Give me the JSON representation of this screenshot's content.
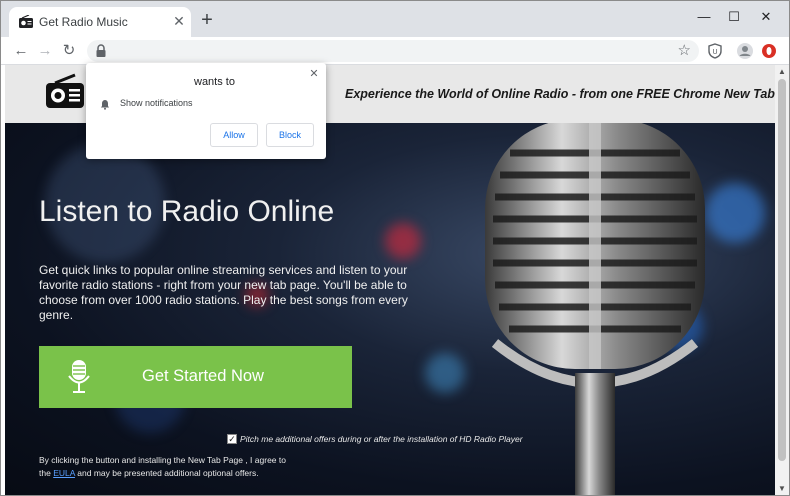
{
  "browser": {
    "tab": {
      "title": "Get Radio Music",
      "close_glyph": "✕",
      "favicon": "radio-icon"
    },
    "new_tab_glyph": "+",
    "window_controls": {
      "minimize": "—",
      "maximize": "☐",
      "close": "✕"
    },
    "nav": {
      "back": "←",
      "forward": "→",
      "reload": "↻"
    },
    "omnibox": {
      "url": "",
      "icon": "lock-icon"
    },
    "bookmark_star": "☆",
    "extensions": [
      "shield-extension-icon",
      "profile-avatar-icon",
      "opera-red-icon"
    ],
    "menu": "⋮"
  },
  "page": {
    "header": {
      "logo": "radio-icon",
      "tagline": "Experience the World of Online Radio - from one FREE Chrome New Tab!"
    },
    "hero": {
      "title": "Listen to Radio Online",
      "description": "Get quick links to popular online streaming services and listen to your favorite radio stations - right from your new tab page. You'll be able to choose from over 1000 radio stations. Play the best songs from every genre.",
      "cta_label": "Get Started Now",
      "cta_icon": "microphone-icon",
      "offer_checked": true,
      "offer_text": "Pitch me additional offers during or after the installation of HD Radio Player",
      "legal_part1": "By clicking the button and installing the New Tab Page , I agree to the ",
      "legal_link": "EULA",
      "legal_part2": " and may be presented additional optional offers."
    }
  },
  "notification": {
    "title": "wants to",
    "permission": "Show notifications",
    "allow_label": "Allow",
    "block_label": "Block",
    "close_glyph": "✕"
  },
  "scrollbar": {
    "up": "▲",
    "down": "▼"
  },
  "colors": {
    "cta_green": "#7ac24a",
    "link_blue": "#1a73e8",
    "header_gray": "#e8e8e8"
  }
}
